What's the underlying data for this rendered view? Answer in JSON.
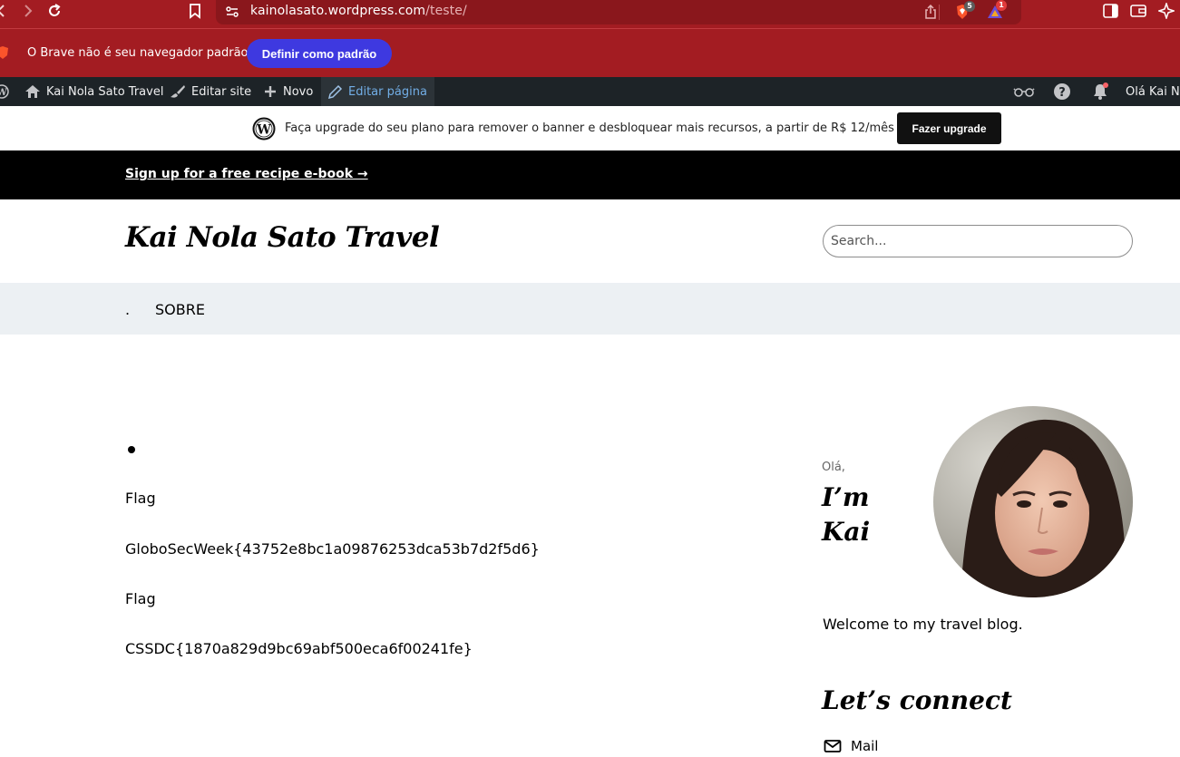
{
  "browser": {
    "url_domain": "kainolasato.wordpress.com",
    "url_path": "/teste/",
    "shields_badge": "5",
    "rewards_badge": "1",
    "icons": [
      "back-icon",
      "forward-icon",
      "reload-icon",
      "bookmark-icon",
      "site-settings-icon",
      "share-icon",
      "brave-shields-icon",
      "brave-rewards-icon",
      "sidebar-icon",
      "wallet-icon",
      "leo-ai-icon"
    ]
  },
  "notice": {
    "text": "O Brave não é seu navegador padrão",
    "button": "Definir como padrão"
  },
  "admin_bar": {
    "site_name": "Kai Nola Sato Travel",
    "edit_site": "Editar site",
    "new": "Novo",
    "edit_page": "Editar página",
    "greeting": "Olá Kai Nola"
  },
  "upgrade_banner": {
    "text": "Faça upgrade do seu plano para remover o banner e desbloquear mais recursos, a partir de R$ 12/mês",
    "button": "Fazer upgrade"
  },
  "site": {
    "promo_link": "Sign up for a free recipe e-book →",
    "title": "Kai Nola Sato Travel",
    "search_placeholder": "Search...",
    "menu": {
      "dot": ".",
      "sobre": "SOBRE"
    },
    "content": {
      "lines": [
        "Flag",
        "GloboSecWeek{43752e8bc1a09876253dca53b7d2f5d6}",
        "Flag",
        "CSSDC{1870a829d9bc69abf500eca6f00241fe}"
      ]
    },
    "sidebar": {
      "hello": "Olá,",
      "im_kai": "I’m\nKai",
      "welcome": "Welcome to my travel blog.",
      "connect_heading": "Let’s connect",
      "mail": "Mail"
    }
  },
  "colors": {
    "browser_red": "#a31c22",
    "notice_button": "#3e39e0",
    "admin_bar": "#1d2327",
    "admin_active_text": "#72aee6",
    "menu_bg": "#ecf0f3"
  }
}
